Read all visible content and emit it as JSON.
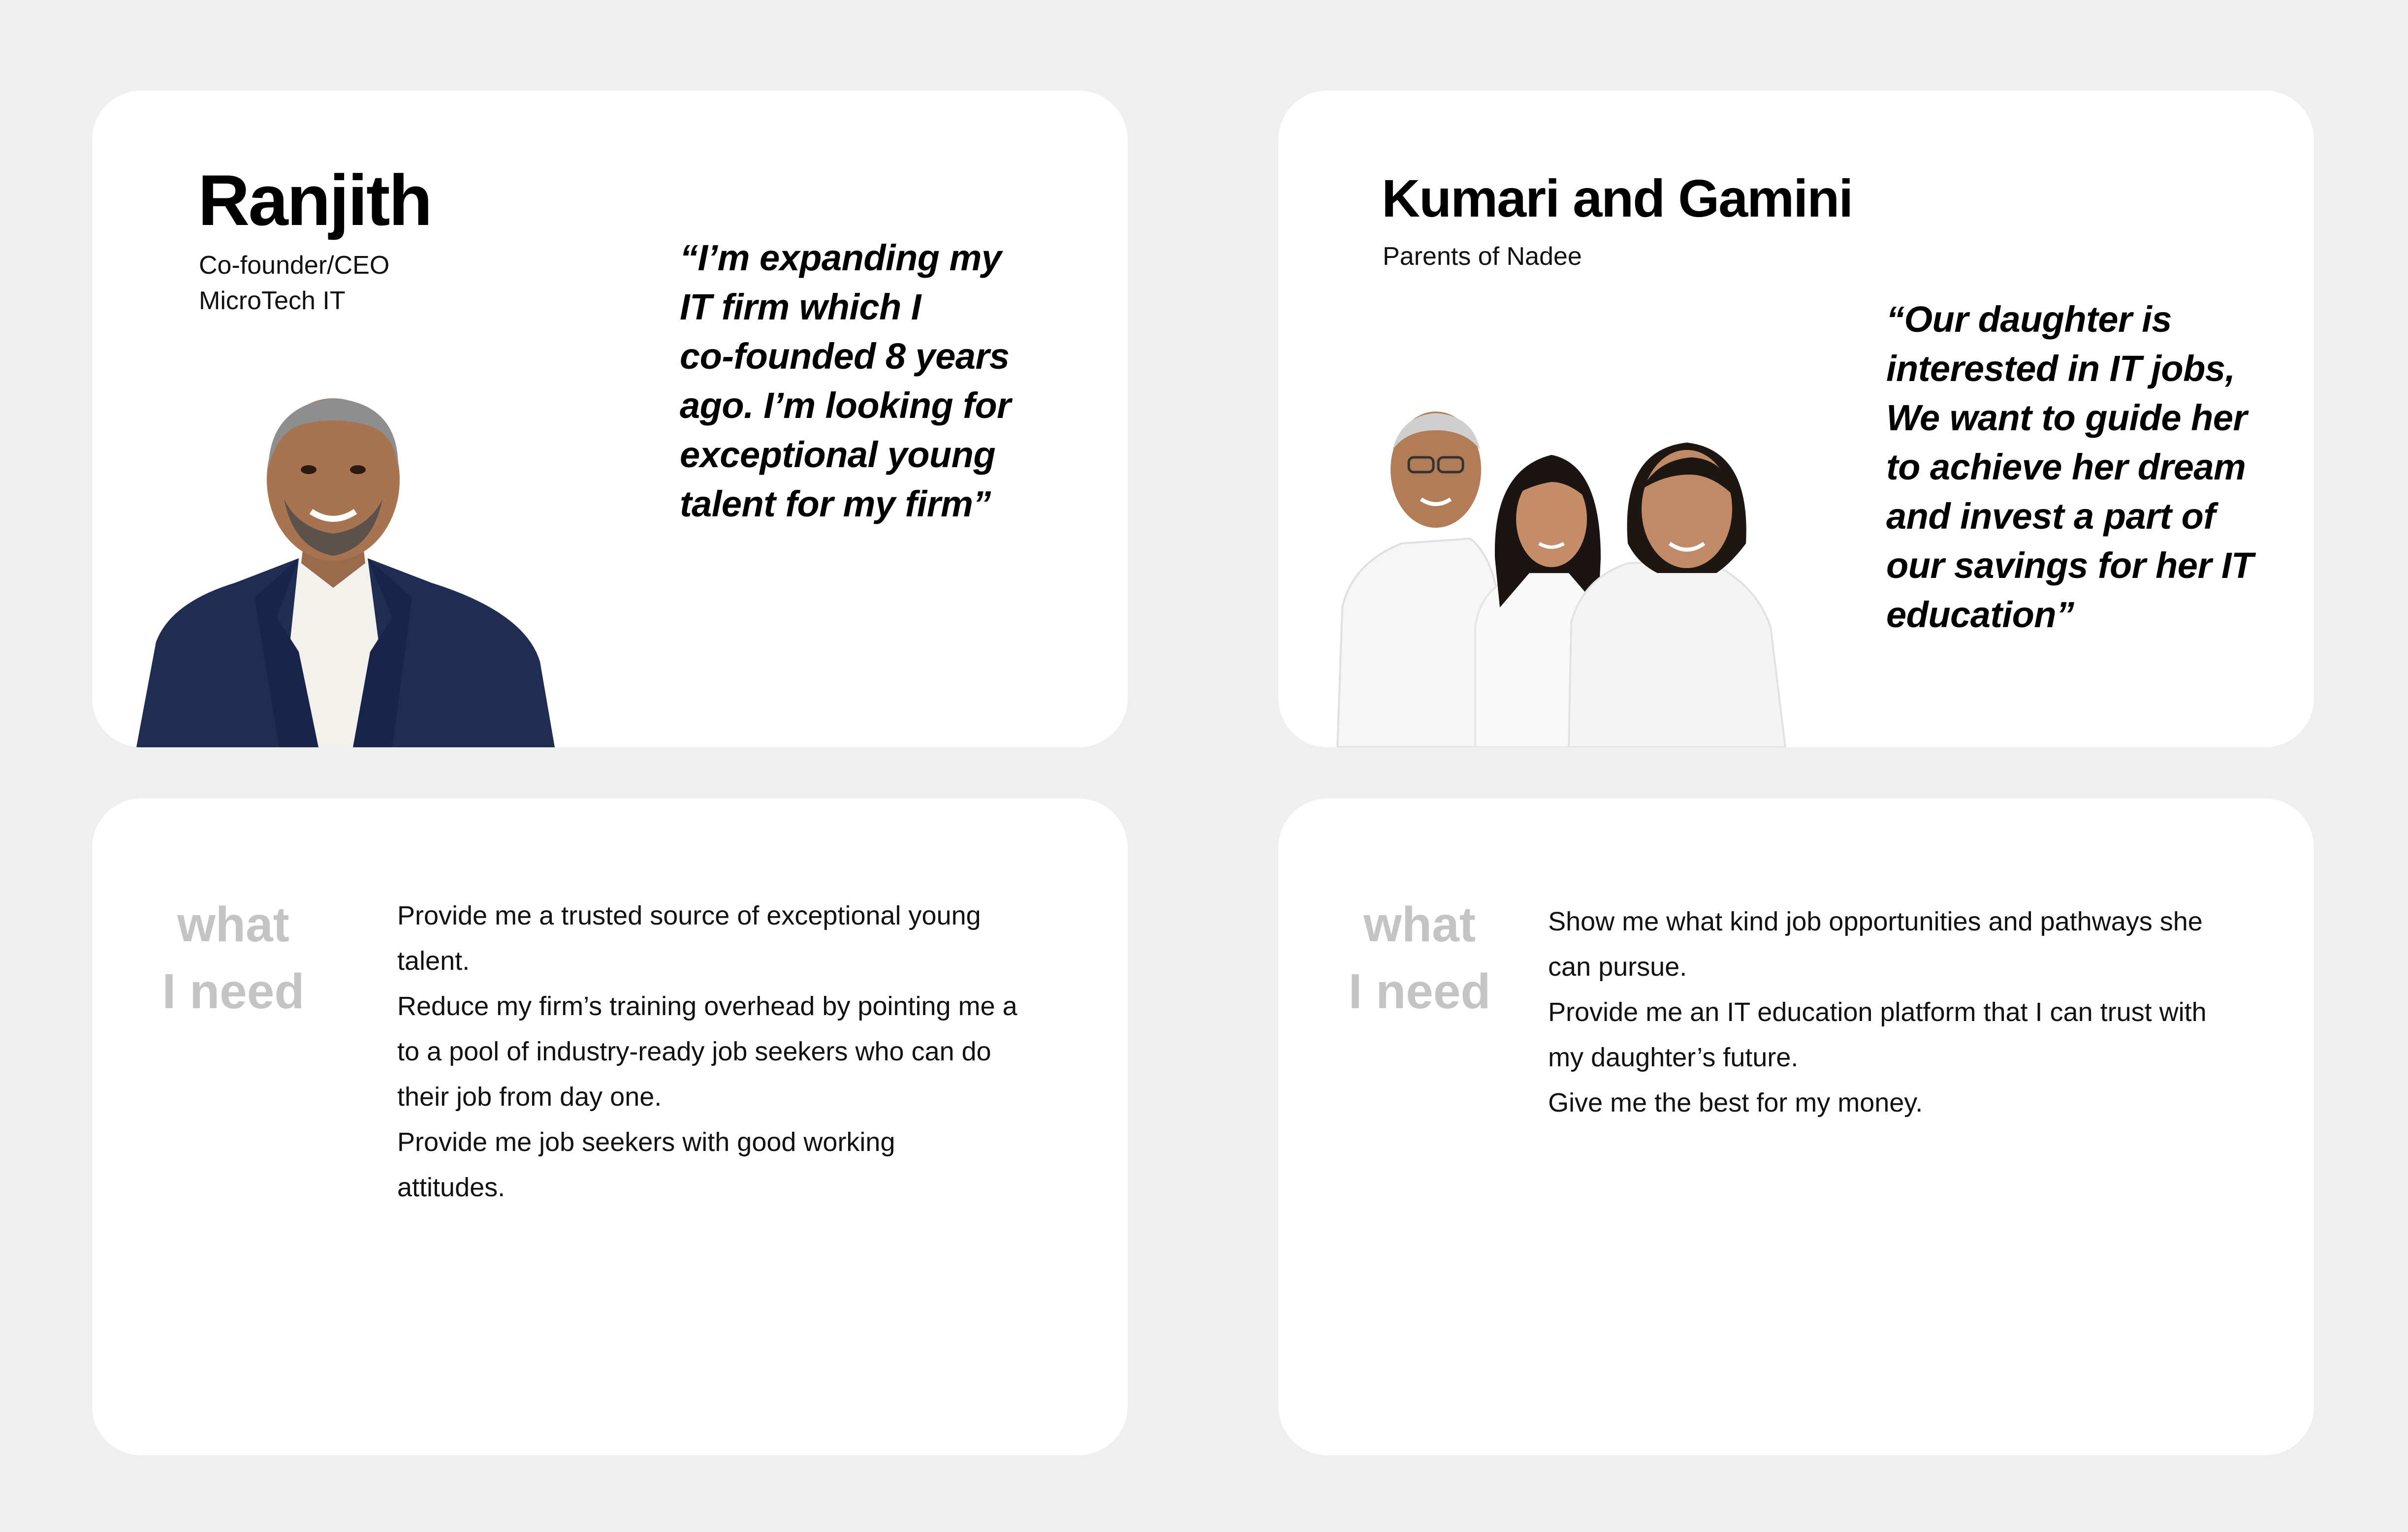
{
  "personas": [
    {
      "name": "Ranjith",
      "role_line1": "Co-founder/CEO",
      "role_line2": "MicroTech IT",
      "quote_lines": [
        "“I’m expanding my",
        "IT firm which I",
        "co-founded 8 years",
        "ago. I’m looking for",
        "exceptional young",
        "talent for my firm”"
      ],
      "need_label": [
        "what",
        "I need"
      ],
      "needs": [
        "Provide me a trusted source of exceptional young",
        "talent.",
        "Reduce my firm’s training overhead by pointing me a",
        "to a pool of industry-ready job seekers who can do",
        "their job from day one.",
        "Provide me job seekers with good working",
        "attitudes."
      ]
    },
    {
      "name": "Kumari and Gamini",
      "role_line1": "Parents of Nadee",
      "quote_lines": [
        "“Our daughter is",
        "interested in IT jobs,",
        "We want to guide her",
        "to achieve her dream",
        "and invest a part of",
        "our savings for her IT",
        "education”"
      ],
      "need_label": [
        "what",
        "I need"
      ],
      "needs": [
        "Show me what kind job opportunities and pathways she",
        "can pursue.",
        "Provide me an IT education platform that I can trust with",
        "my daughter’s future.",
        "Give me the best for my money."
      ]
    }
  ],
  "colors": {
    "background": "#efefef",
    "card": "#ffffff",
    "label_gray": "#c4c4c4",
    "suit_navy": "#1f2d52"
  }
}
